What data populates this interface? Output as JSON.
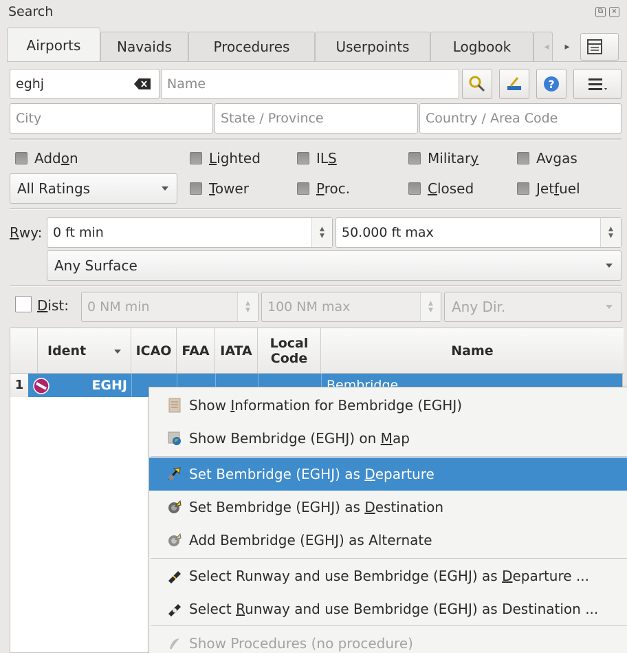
{
  "window": {
    "title": "Search",
    "restore_glyph": "⧉",
    "close_glyph": "×"
  },
  "tabs": [
    {
      "label": "Airports",
      "active": true
    },
    {
      "label": "Navaids"
    },
    {
      "label": "Procedures"
    },
    {
      "label": "Userpoints"
    },
    {
      "label": "Logbook"
    }
  ],
  "search": {
    "ident_value": "eghj",
    "name_placeholder": "Name",
    "city_placeholder": "City",
    "state_placeholder": "State / Province",
    "country_placeholder": "Country / Area Code"
  },
  "filters": {
    "addon": {
      "pre": "Add",
      "ul": "o",
      "post": "n"
    },
    "lighted": {
      "pre": "",
      "ul": "L",
      "post": "ighted"
    },
    "ils": {
      "pre": "IL",
      "ul": "S",
      "post": ""
    },
    "military": {
      "pre": "Militar",
      "ul": "y",
      "post": ""
    },
    "avgas": {
      "pre": "Av",
      "ul": "g",
      "post": "as"
    },
    "ratings": "All Ratings",
    "tower": {
      "pre": "",
      "ul": "T",
      "post": "ower"
    },
    "proc": {
      "pre": "",
      "ul": "P",
      "post": "roc."
    },
    "closed": {
      "pre": "",
      "ul": "C",
      "post": "losed"
    },
    "jetfuel": {
      "pre": "Jet",
      "ul": "f",
      "post": "uel"
    }
  },
  "runway": {
    "label": {
      "pre": "",
      "ul": "R",
      "post": "wy:"
    },
    "min_value": "0 ft min",
    "max_value": "50.000 ft max",
    "surface": "Any Surface"
  },
  "distance": {
    "label": {
      "pre": "",
      "ul": "D",
      "post": "ist:"
    },
    "min_value": "0 NM min",
    "max_value": "100 NM max",
    "direction": "Any Dir."
  },
  "table": {
    "headers": {
      "ident": "Ident",
      "icao": "ICAO",
      "faa": "FAA",
      "iata": "IATA",
      "local_code": "Local Code",
      "name": "Name"
    },
    "rows": [
      {
        "index": "1",
        "ident": "EGHJ",
        "icao": "",
        "faa": "",
        "iata": "",
        "local_code": "",
        "name": "Bembridge"
      }
    ]
  },
  "context_menu": {
    "items": [
      {
        "pre": "Show ",
        "ul": "I",
        "post": "nformation for Bembridge (EGHJ)",
        "icon": "info-icon"
      },
      {
        "pre": "Show Bembridge (EGHJ) on ",
        "ul": "M",
        "post": "ap",
        "icon": "globe-map-icon"
      },
      {
        "pre": "Set Bembridge (EGHJ) as ",
        "ul": "D",
        "post": "eparture",
        "icon": "departure-flag-icon",
        "highlighted": true
      },
      {
        "pre": "Set Bembridge (EGHJ) as ",
        "ul": "D",
        "post": "estination",
        "icon": "destination-flag-icon"
      },
      {
        "pre": "Add Bembridge (EGHJ) as Alternate",
        "ul": "",
        "post": "",
        "icon": "alternate-flag-icon"
      },
      {
        "pre": "Select Runway and use Bembridge (EGHJ) as ",
        "ul": "D",
        "post": "eparture ...",
        "icon": "runway-departure-icon"
      },
      {
        "pre": "Select ",
        "ul": "R",
        "post": "unway and use Bembridge (EGHJ) as Destination ...",
        "icon": "runway-destination-icon"
      },
      {
        "pre": "Show Procedures (no procedure)",
        "ul": "",
        "post": "",
        "icon": "procedures-icon",
        "disabled": true
      }
    ]
  },
  "colors": {
    "highlight": "#3f8ccd",
    "airport_icon": "#b0226a",
    "help_button": "#3a7fd5"
  }
}
